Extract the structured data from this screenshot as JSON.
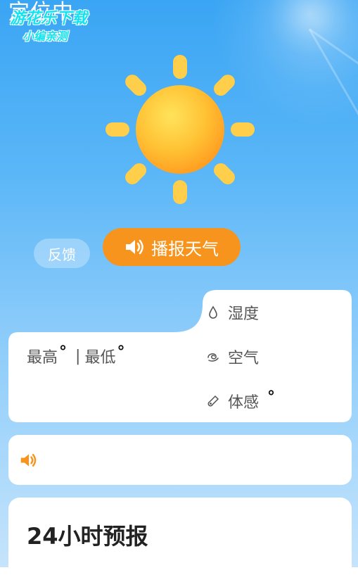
{
  "header": {
    "title": "定位中",
    "watermark_line1": "游花乐下载",
    "watermark_line2": "小编亲测"
  },
  "weather_icon": "sun-icon",
  "actions": {
    "feedback_label": "反馈",
    "broadcast_label": "播报天气",
    "broadcast_icon": "speaker-icon"
  },
  "today": {
    "high_label": "最高",
    "high_value": "",
    "low_label": "最低",
    "low_value": "",
    "degree_symbol": "°",
    "separator": "|"
  },
  "stats": [
    {
      "icon": "droplet-icon",
      "label": "湿度",
      "value": ""
    },
    {
      "icon": "wind-swirl-icon",
      "label": "空气",
      "value": ""
    },
    {
      "icon": "thermometer-icon",
      "label": "体感",
      "value": "°"
    }
  ],
  "voice": {
    "icon": "speaker-icon",
    "text": ""
  },
  "forecast": {
    "title": "24小时预报"
  },
  "colors": {
    "sky_top": "#3aa5f4",
    "sky_bottom": "#c6e4fb",
    "accent_orange": "#f7941e",
    "sun_core": "#ffb02e",
    "sun_ray": "#ffce4a"
  }
}
